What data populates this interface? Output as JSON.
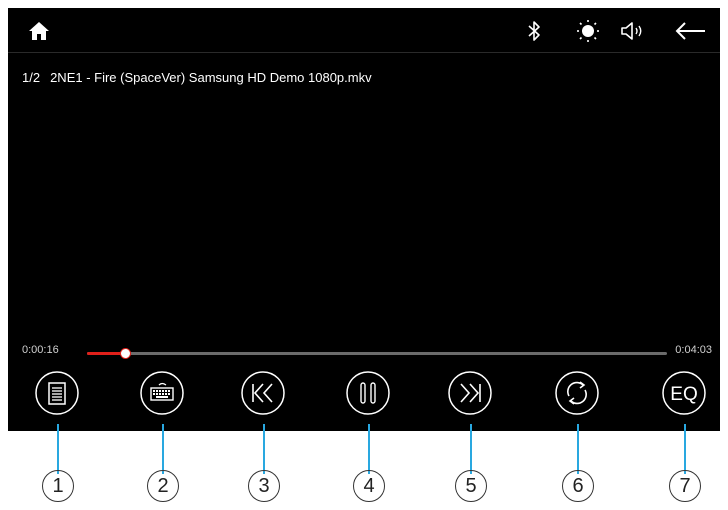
{
  "player": {
    "track_index": "1/2",
    "filename": "2NE1 - Fire (SpaceVer) Samsung HD Demo 1080p.mkv",
    "elapsed": "0:00:16",
    "total": "0:04:03",
    "progress": 0.066
  },
  "topbar": {
    "icons": [
      "home-icon",
      "bluetooth-icon",
      "brightness-icon",
      "volume-icon",
      "back-arrow-icon"
    ]
  },
  "controls": [
    {
      "name": "playlist-button",
      "icon": "playlist-icon",
      "callout": "1"
    },
    {
      "name": "keyboard-button",
      "icon": "keyboard-icon",
      "callout": "2"
    },
    {
      "name": "previous-button",
      "icon": "skip-previous-icon",
      "callout": "3"
    },
    {
      "name": "pause-button",
      "icon": "pause-icon",
      "callout": "4"
    },
    {
      "name": "next-button",
      "icon": "skip-next-icon",
      "callout": "5"
    },
    {
      "name": "repeat-button",
      "icon": "repeat-icon",
      "callout": "6"
    },
    {
      "name": "eq-button",
      "icon": "eq-icon",
      "label": "EQ",
      "callout": "7"
    }
  ],
  "colors": {
    "screen_bg": "#000000",
    "progress_played": "#e0201a",
    "progress_track": "#6b6b6b",
    "callout_line": "#29a8e0"
  }
}
